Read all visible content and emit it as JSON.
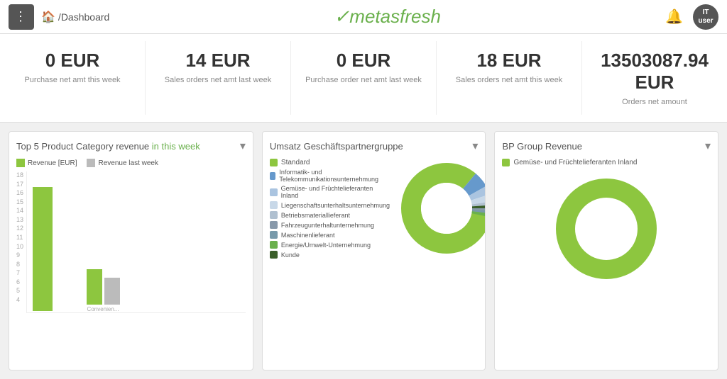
{
  "topbar": {
    "menu_icon": "⋮",
    "home_icon": "⌂",
    "breadcrumb_separator": "/",
    "breadcrumb_page": "Dashboard",
    "logo_text": "metasfresh",
    "bell_icon": "🔔",
    "avatar_line1": "IT",
    "avatar_line2": "user"
  },
  "metrics": [
    {
      "value": "0 EUR",
      "label": "Purchase net amt this week"
    },
    {
      "value": "14 EUR",
      "label": "Sales orders net amt last week"
    },
    {
      "value": "0 EUR",
      "label": "Purchase order net amt last week"
    },
    {
      "value": "18 EUR",
      "label": "Sales orders net amt this week"
    },
    {
      "value": "13503087.94 EUR",
      "label": "Orders net amount"
    }
  ],
  "charts": {
    "bar": {
      "title_start": "Top 5 Product Category revenue ",
      "title_highlight": "in this week",
      "legend_revenue": "Revenue [EUR]",
      "legend_last_week": "Revenue last week",
      "y_labels": [
        "18",
        "17",
        "16",
        "15",
        "14",
        "13",
        "12",
        "11",
        "10",
        "9",
        "8",
        "7",
        "6",
        "5",
        "4"
      ],
      "bars": [
        {
          "green_height": 175,
          "gray_height": 0,
          "label": ""
        },
        {
          "green_height": 50,
          "gray_height": 35,
          "label": "Convenien..."
        }
      ]
    },
    "donut": {
      "title": "Umsatz Geschäftspartnergruppe",
      "legend": [
        {
          "color": "#8dc63f",
          "label": "Standard"
        },
        {
          "color": "#6699cc",
          "label": "Informatik- und Telekommunikationsunternehmung"
        },
        {
          "color": "#aac4e0",
          "label": "Gemüse- und Früchtelieferanten Inland"
        },
        {
          "color": "#c8d8e8",
          "label": "Liegenschaftsunterhaltsunternehmung"
        },
        {
          "color": "#b0c0d0",
          "label": "Betriebsmateriallieferant"
        },
        {
          "color": "#8899aa",
          "label": "Fahrzeugunterhaltunternehmung"
        },
        {
          "color": "#7799aa",
          "label": "Maschinenlieferant"
        },
        {
          "color": "#6ab04c",
          "label": "Energie/Umwelt-Unternehmung"
        },
        {
          "color": "#3a5f2a",
          "label": "Kunde"
        }
      ]
    },
    "bp_group": {
      "title": "BP Group Revenue",
      "legend_label": "Gemüse- und Früchtelieferanten Inland"
    }
  }
}
